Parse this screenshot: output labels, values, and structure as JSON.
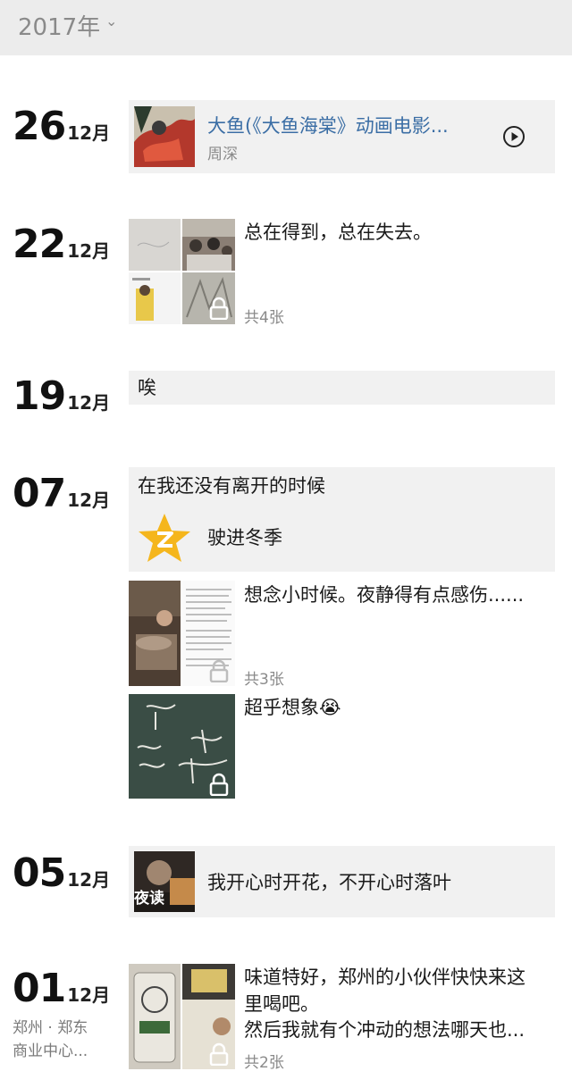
{
  "header": {
    "year": "2017年"
  },
  "entries": [
    {
      "day": "26",
      "month": "12月",
      "music_title": "大鱼(《大鱼海棠》动画电影...",
      "music_artist": "周深"
    },
    {
      "day": "22",
      "month": "12月",
      "text": "总在得到，总在失去。",
      "count": "共4张"
    },
    {
      "day": "19",
      "month": "12月",
      "text": "唉"
    },
    {
      "day": "07",
      "month": "12月",
      "share_text": "在我还没有离开的时候",
      "share_link": "驶进冬季",
      "post1_text": "想念小时候。夜静得有点感伤......",
      "post1_count": "共3张",
      "post2_text": "超乎想象😭"
    },
    {
      "day": "05",
      "month": "12月",
      "share_text": "我开心时开花，不开心时落叶",
      "thumb_label": "夜读"
    },
    {
      "day": "01",
      "month": "12月",
      "location_line1": "郑州 · 郑东",
      "location_line2": "商业中心...",
      "text_line1": "味道特好，郑州的小伙伴快快来这",
      "text_line2": "里喝吧。",
      "text_line3": "然后我就有个冲动的想法哪天也...",
      "count": "共2张"
    }
  ],
  "colors": {
    "header_bg": "#ececec",
    "card_bg": "#f1f1f1",
    "muted_text": "#8a8a8a",
    "qzone_star": "#f5b61c"
  }
}
